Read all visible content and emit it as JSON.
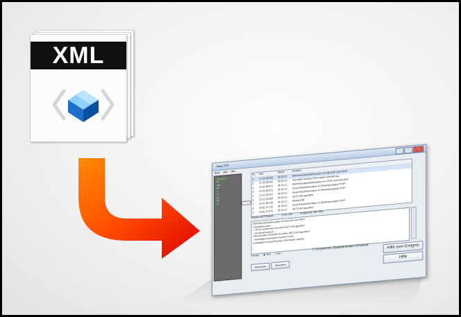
{
  "file_icon": {
    "label": "XML",
    "icon": "file-xml-icon",
    "band_color": "#101010"
  },
  "arrow": {
    "icon": "curved-arrow-icon",
    "color_start": "#ff6a00",
    "color_end": "#e10000"
  },
  "window": {
    "title": "Meld. FPE",
    "menu": [
      "Datei",
      "Bild",
      "Hilfe"
    ],
    "sidebar": [
      "Statusblock",
      "PS",
      "CPU",
      "E/A",
      "DI",
      "DO",
      "AI",
      "AO",
      "CP"
    ],
    "columns": {
      "nr": "Nr.",
      "zeit": "Zeit",
      "datum": "Datum",
      "ereignis": "Ereignis"
    },
    "rows": [
      {
        "nr": "1",
        "zeit": "22:26:36:683",
        "datum": "06.02.12",
        "ereignis": "Betriebszustandsübergang von ANLAUF nach RUN"
      },
      {
        "nr": "2",
        "zeit": "22:26:36:582",
        "datum": "06.02.12",
        "ereignis": "Manuelle Neustart (Warmstart)-Anforderung"
      },
      {
        "nr": "3",
        "zeit": "22:26:36:377",
        "datum": "06.02.12",
        "ereignis": "Betriebszustandsübergang von STOP nach ANLAUF"
      },
      {
        "nr": "4",
        "zeit": "22:26:36:371",
        "datum": "06.02.12",
        "ereignis": "Neue Anlaufinformation im Betriebszustand STOP"
      },
      {
        "nr": "5",
        "zeit": "22:22:03:367",
        "datum": "06.02.12",
        "ereignis": "Neue Anlaufinformation im Betriebszustand STOP"
      },
      {
        "nr": "6",
        "zeit": "22:22:03:356",
        "datum": "06.02.12",
        "ereignis": "NETZ EIN gepuffert"
      },
      {
        "nr": "7",
        "zeit": "02:47:05:218",
        "datum": "06.02.12",
        "ereignis": "Netzausfall"
      },
      {
        "nr": "8",
        "zeit": "20:01:47:175",
        "datum": "06.02.12",
        "ereignis": "Neue Anlaufinformation im Betriebszustand STOP"
      },
      {
        "nr": "9",
        "zeit": "20:01:47:170",
        "datum": "06.02.12",
        "ereignis": "NETZ EIN gepuffert"
      }
    ],
    "details_label": "Details zum Ereignis:",
    "details_counter": "1 von 120",
    "event_id": "Ereignis-ID: 16# 4302",
    "details_text": [
      "Betriebszustandsübergang von ANLAUF nach RUN",
      "Anlaufinformation:",
      "- Uhr für Zeitstempel bei letzter NETZ EIN gepuffert",
      "- Einzelinstruktionen:",
      "Anlaufschalter (Anlaufart bei letzter NETZ EIN gepuffert)",
      "- Zulässigkeit manuellen Neustart in Kalt",
      "Zulässigkeit manuell Neustart (Warmstart) zulässig"
    ],
    "format_label": "Format:",
    "format_options": [
      "Text",
      "Hex"
    ],
    "utc_label": "Uhrzeit incl. Zeitunterschied CPU/local",
    "buttons": {
      "abbrechen": "Abbrechen",
      "speichern": "Speichern",
      "hilfe_ereignis": "Hilfe zum Ereignis",
      "hilfe": "Hilfe"
    }
  }
}
